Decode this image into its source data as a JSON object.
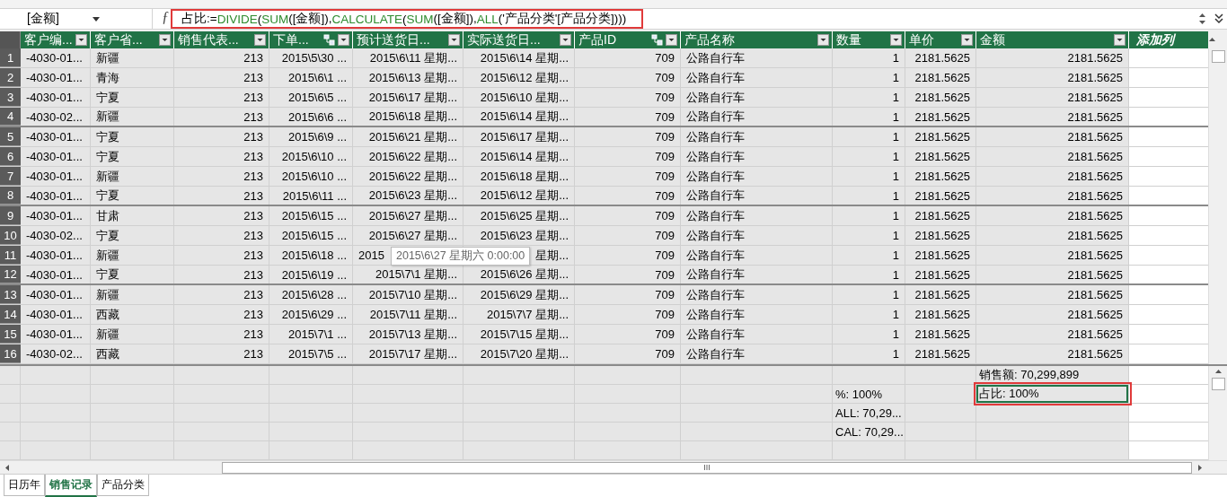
{
  "formula_bar": {
    "name_box": "[金额]",
    "fx": "ƒ",
    "highlighted": true,
    "formula": [
      {
        "text": "占比:=",
        "kind": "plain"
      },
      {
        "text": "DIVIDE",
        "kind": "function"
      },
      {
        "text": "(",
        "kind": "plain"
      },
      {
        "text": "SUM",
        "kind": "function"
      },
      {
        "text": "([金额]),",
        "kind": "plain"
      },
      {
        "text": "CALCULATE",
        "kind": "function"
      },
      {
        "text": "(",
        "kind": "plain"
      },
      {
        "text": "SUM",
        "kind": "function"
      },
      {
        "text": "([金额]),",
        "kind": "plain"
      },
      {
        "text": "ALL",
        "kind": "function"
      },
      {
        "text": "('产品分类'[产品分类])))",
        "kind": "plain"
      }
    ]
  },
  "table": {
    "columns": [
      {
        "label": "客户编...",
        "kind": "text",
        "related": false
      },
      {
        "label": "客户省...",
        "kind": "text",
        "related": false
      },
      {
        "label": "销售代表...",
        "kind": "number",
        "related": false
      },
      {
        "label": "下单...",
        "kind": "number",
        "related": true
      },
      {
        "label": "预计送货日...",
        "kind": "number",
        "related": false
      },
      {
        "label": "实际送货日...",
        "kind": "number",
        "related": false
      },
      {
        "label": "产品ID",
        "kind": "number",
        "related": true
      },
      {
        "label": "产品名称",
        "kind": "text",
        "related": false
      },
      {
        "label": "数量",
        "kind": "number",
        "related": false
      },
      {
        "label": "单价",
        "kind": "number",
        "related": false
      },
      {
        "label": "金额",
        "kind": "number",
        "related": false
      }
    ],
    "add_column": "添加列",
    "rows": [
      {
        "number": "1",
        "cells": [
          "-4030-01...",
          "新疆",
          "213",
          "2015\\5\\30 ...",
          "2015\\6\\11 星期...",
          "2015\\6\\14 星期...",
          "709",
          "公路自行车",
          "1",
          "2181.5625",
          "2181.5625"
        ]
      },
      {
        "number": "2",
        "cells": [
          "-4030-01...",
          "青海",
          "213",
          "2015\\6\\1 ...",
          "2015\\6\\13 星期...",
          "2015\\6\\12 星期...",
          "709",
          "公路自行车",
          "1",
          "2181.5625",
          "2181.5625"
        ]
      },
      {
        "number": "3",
        "cells": [
          "-4030-01...",
          "宁夏",
          "213",
          "2015\\6\\5 ...",
          "2015\\6\\17 星期...",
          "2015\\6\\10 星期...",
          "709",
          "公路自行车",
          "1",
          "2181.5625",
          "2181.5625"
        ]
      },
      {
        "number": "4",
        "cells": [
          "-4030-02...",
          "新疆",
          "213",
          "2015\\6\\6 ...",
          "2015\\6\\18 星期...",
          "2015\\6\\14 星期...",
          "709",
          "公路自行车",
          "1",
          "2181.5625",
          "2181.5625"
        ]
      },
      {
        "number": "5",
        "cells": [
          "-4030-01...",
          "宁夏",
          "213",
          "2015\\6\\9 ...",
          "2015\\6\\21 星期...",
          "2015\\6\\17 星期...",
          "709",
          "公路自行车",
          "1",
          "2181.5625",
          "2181.5625"
        ]
      },
      {
        "number": "6",
        "cells": [
          "-4030-01...",
          "宁夏",
          "213",
          "2015\\6\\10 ...",
          "2015\\6\\22 星期...",
          "2015\\6\\14 星期...",
          "709",
          "公路自行车",
          "1",
          "2181.5625",
          "2181.5625"
        ]
      },
      {
        "number": "7",
        "cells": [
          "-4030-01...",
          "新疆",
          "213",
          "2015\\6\\10 ...",
          "2015\\6\\22 星期...",
          "2015\\6\\18 星期...",
          "709",
          "公路自行车",
          "1",
          "2181.5625",
          "2181.5625"
        ]
      },
      {
        "number": "8",
        "cells": [
          "-4030-01...",
          "宁夏",
          "213",
          "2015\\6\\11 ...",
          "2015\\6\\23 星期...",
          "2015\\6\\12 星期...",
          "709",
          "公路自行车",
          "1",
          "2181.5625",
          "2181.5625"
        ]
      },
      {
        "number": "9",
        "cells": [
          "-4030-01...",
          "甘肃",
          "213",
          "2015\\6\\15 ...",
          "2015\\6\\27 星期...",
          "2015\\6\\25 星期...",
          "709",
          "公路自行车",
          "1",
          "2181.5625",
          "2181.5625"
        ]
      },
      {
        "number": "10",
        "cells": [
          "-4030-02...",
          "宁夏",
          "213",
          "2015\\6\\15 ...",
          "2015\\6\\27 星期...",
          "2015\\6\\23 星期...",
          "709",
          "公路自行车",
          "1",
          "2181.5625",
          "2181.5625"
        ]
      },
      {
        "number": "11",
        "cells": [
          "-4030-01...",
          "新疆",
          "213",
          "2015\\6\\18 ...",
          "2015",
          "星期...",
          "709",
          "公路自行车",
          "1",
          "2181.5625",
          "2181.5625"
        ],
        "tooltip": "2015\\6\\27 星期六 0:00:00"
      },
      {
        "number": "12",
        "cells": [
          "-4030-01...",
          "宁夏",
          "213",
          "2015\\6\\19 ...",
          "2015\\7\\1 星期...",
          "2015\\6\\26 星期...",
          "709",
          "公路自行车",
          "1",
          "2181.5625",
          "2181.5625"
        ]
      },
      {
        "number": "13",
        "cells": [
          "-4030-01...",
          "新疆",
          "213",
          "2015\\6\\28 ...",
          "2015\\7\\10 星期...",
          "2015\\6\\29 星期...",
          "709",
          "公路自行车",
          "1",
          "2181.5625",
          "2181.5625"
        ]
      },
      {
        "number": "14",
        "cells": [
          "-4030-01...",
          "西藏",
          "213",
          "2015\\6\\29 ...",
          "2015\\7\\11 星期...",
          "2015\\7\\7 星期...",
          "709",
          "公路自行车",
          "1",
          "2181.5625",
          "2181.5625"
        ]
      },
      {
        "number": "15",
        "cells": [
          "-4030-01...",
          "新疆",
          "213",
          "2015\\7\\1 ...",
          "2015\\7\\13 星期...",
          "2015\\7\\15 星期...",
          "709",
          "公路自行车",
          "1",
          "2181.5625",
          "2181.5625"
        ]
      },
      {
        "number": "16",
        "cells": [
          "-4030-02...",
          "西藏",
          "213",
          "2015\\7\\5 ...",
          "2015\\7\\17 星期...",
          "2015\\7\\20 星期...",
          "709",
          "公路自行车",
          "1",
          "2181.5625",
          "2181.5625"
        ]
      }
    ]
  },
  "measure_rows": [
    {
      "cells": [
        null,
        null,
        null,
        null,
        null,
        null,
        null,
        null,
        null,
        null,
        {
          "text": "销售额: 70,299,899",
          "selected": false,
          "highlighted": false
        }
      ]
    },
    {
      "cells": [
        null,
        null,
        null,
        null,
        null,
        null,
        null,
        null,
        {
          "text": "%: 100%",
          "selected": false,
          "highlighted": false
        },
        null,
        {
          "text": "占比: 100%",
          "selected": true,
          "highlighted": true
        }
      ]
    },
    {
      "cells": [
        null,
        null,
        null,
        null,
        null,
        null,
        null,
        null,
        {
          "text": "ALL: 70,29...",
          "selected": false,
          "highlighted": false
        },
        null,
        null
      ]
    },
    {
      "cells": [
        null,
        null,
        null,
        null,
        null,
        null,
        null,
        null,
        {
          "text": "CAL: 70,29...",
          "selected": false,
          "highlighted": false
        },
        null,
        null
      ]
    },
    {
      "cells": [
        null,
        null,
        null,
        null,
        null,
        null,
        null,
        null,
        null,
        null,
        null
      ]
    }
  ],
  "horizontal_scroll_grip": "III",
  "sheet_tabs": [
    {
      "label": "日历年",
      "selected": false
    },
    {
      "label": "销售记录",
      "selected": true
    },
    {
      "label": "产品分类",
      "selected": false
    }
  ]
}
